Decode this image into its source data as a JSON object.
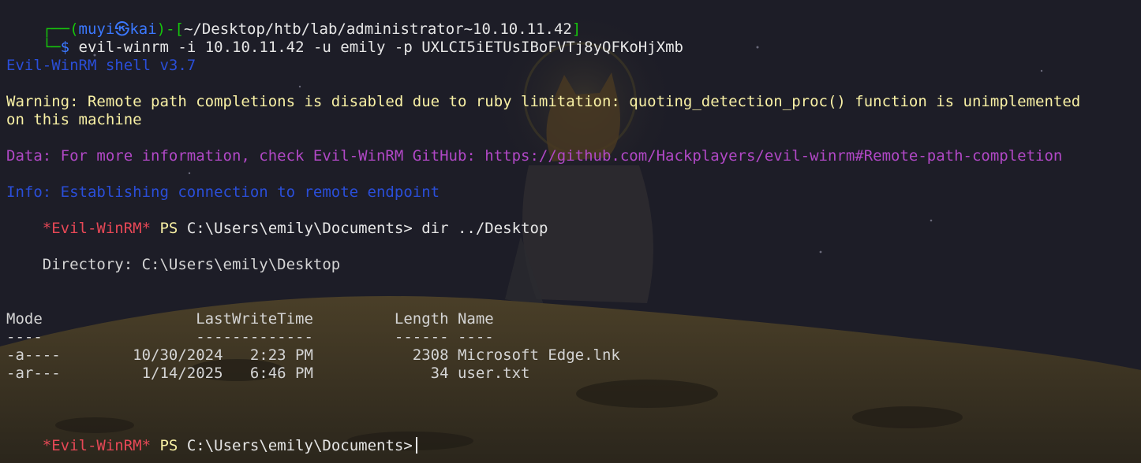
{
  "prompt": {
    "box_top": "┌──(",
    "user": "muyi",
    "skull": "㉿",
    "host": "kai",
    "close_paren": ")-[",
    "path": "~/Desktop/htb/lab/administrator~10.10.11.42",
    "close_bracket": "]",
    "box_bottom": "└─",
    "dollar": "$",
    "command": " evil-winrm -i 10.10.11.42 -u emily -p UXLCI5iETUsIBoFVTj8yQFKoHjXmb"
  },
  "output": {
    "shell_version": "Evil-WinRM shell v3.7",
    "warning_1": "Warning: Remote path completions is disabled due to ruby limitation: quoting_detection_proc() function is unimplemented",
    "warning_2": "on this machine",
    "data_line": "Data: For more information, check Evil-WinRM GitHub: https://github.com/Hackplayers/evil-winrm#Remote-path-completion",
    "info_line": "Info: Establishing connection to remote endpoint"
  },
  "ps_prompt_1": {
    "tag": "*Evil-WinRM*",
    "ps": " PS ",
    "path": "C:\\Users\\emily\\Documents>",
    "command": " dir ../Desktop"
  },
  "listing": {
    "directory": "    Directory: C:\\Users\\emily\\Desktop",
    "header": "Mode                 LastWriteTime         Length Name",
    "underline": "----                 -------------         ------ ----",
    "rows": [
      "-a----        10/30/2024   2:23 PM           2308 Microsoft Edge.lnk",
      "-ar---         1/14/2025   6:46 PM             34 user.txt"
    ]
  },
  "ps_prompt_2": {
    "tag": "*Evil-WinRM*",
    "ps": " PS ",
    "path": "C:\\Users\\emily\\Documents>",
    "command": " "
  },
  "colors": {
    "green": "#16c60c",
    "blue": "#3b78ff",
    "yellow": "#f9f1a5",
    "purple": "#b148c6",
    "red": "#e74856"
  }
}
